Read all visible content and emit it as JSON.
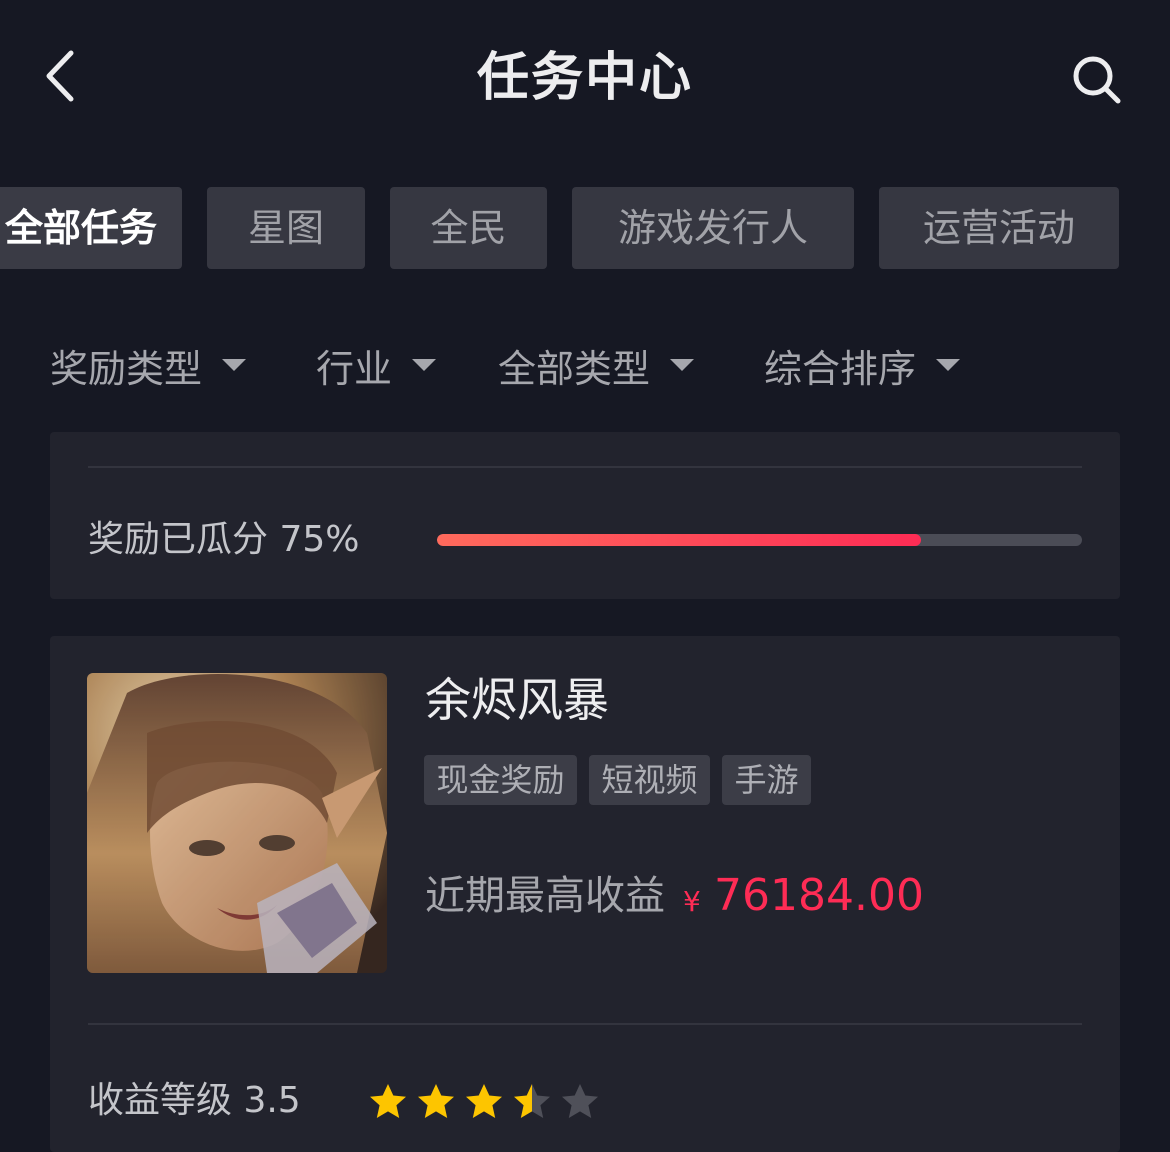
{
  "header": {
    "title": "任务中心",
    "back_icon": "chevron-left-icon",
    "search_icon": "search-icon"
  },
  "tabs": [
    {
      "label": "全部任务",
      "active": true
    },
    {
      "label": "星图",
      "active": false
    },
    {
      "label": "全民",
      "active": false
    },
    {
      "label": "游戏发行人",
      "active": false
    },
    {
      "label": "运营活动",
      "active": false
    }
  ],
  "filters": [
    {
      "label": "奖励类型"
    },
    {
      "label": "行业"
    },
    {
      "label": "全部类型"
    },
    {
      "label": "综合排序"
    }
  ],
  "progress_card": {
    "label": "奖励已瓜分 75%",
    "progress_fraction": 0.75
  },
  "task_card": {
    "title": "余烬风暴",
    "tags": [
      "现金奖励",
      "短视频",
      "手游"
    ],
    "income_label": "近期最高收益",
    "currency": "¥",
    "income_value": "76184.00",
    "level_label": "收益等级 3.5",
    "rating": 3.5,
    "rating_max": 5
  },
  "colors": {
    "background": "#161823",
    "card": "#22232d",
    "accent": "#fe2c55",
    "star": "#fdc500",
    "star_empty": "#4f5059"
  }
}
